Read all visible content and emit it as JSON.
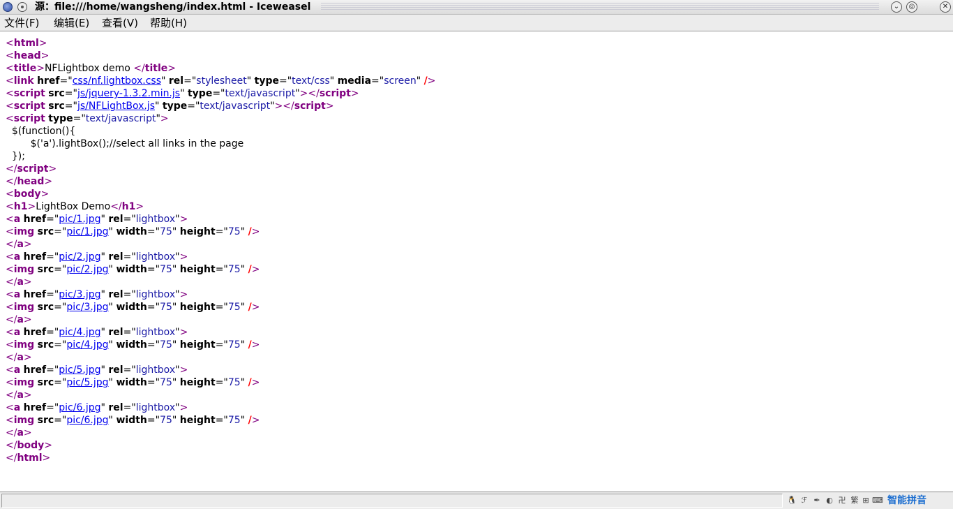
{
  "window": {
    "title": "源：file:///home/wangsheng/index.html - Iceweasel",
    "minimize_glyph": "⌄",
    "maximize_glyph": "◎"
  },
  "menu": [
    "文件(F)",
    "编辑(E)",
    "查看(V)",
    "帮助(H)"
  ],
  "source_lines": [
    [
      [
        "a",
        "<"
      ],
      [
        "t",
        "html"
      ],
      [
        "a",
        ">"
      ]
    ],
    [
      [
        "a",
        "<"
      ],
      [
        "t",
        "head"
      ],
      [
        "a",
        ">"
      ]
    ],
    [
      [
        "a",
        "<"
      ],
      [
        "t",
        "title"
      ],
      [
        "a",
        ">"
      ],
      [
        "p",
        "NFLightbox demo "
      ],
      [
        "a",
        "</"
      ],
      [
        "t",
        "title"
      ],
      [
        "a",
        ">"
      ]
    ],
    [
      [
        "a",
        "<"
      ],
      [
        "t",
        "link"
      ],
      [
        "p",
        " "
      ],
      [
        "k",
        "href"
      ],
      [
        "p",
        "=\""
      ],
      [
        "l",
        "css/nf.lightbox.css"
      ],
      [
        "p",
        "\" "
      ],
      [
        "k",
        "rel"
      ],
      [
        "p",
        "=\""
      ],
      [
        "v",
        "stylesheet"
      ],
      [
        "p",
        "\" "
      ],
      [
        "k",
        "type"
      ],
      [
        "p",
        "=\""
      ],
      [
        "v",
        "text/css"
      ],
      [
        "p",
        "\" "
      ],
      [
        "k",
        "media"
      ],
      [
        "p",
        "=\""
      ],
      [
        "v",
        "screen"
      ],
      [
        "p",
        "\" "
      ],
      [
        "s",
        "/"
      ],
      [
        "a",
        ">"
      ]
    ],
    [
      [
        "a",
        "<"
      ],
      [
        "t",
        "script"
      ],
      [
        "p",
        " "
      ],
      [
        "k",
        "src"
      ],
      [
        "p",
        "=\""
      ],
      [
        "l",
        "js/jquery-1.3.2.min.js"
      ],
      [
        "p",
        "\" "
      ],
      [
        "k",
        "type"
      ],
      [
        "p",
        "=\""
      ],
      [
        "v",
        "text/javascript"
      ],
      [
        "p",
        "\""
      ],
      [
        "a",
        "></"
      ],
      [
        "t",
        "script"
      ],
      [
        "a",
        ">"
      ]
    ],
    [
      [
        "a",
        "<"
      ],
      [
        "t",
        "script"
      ],
      [
        "p",
        " "
      ],
      [
        "k",
        "src"
      ],
      [
        "p",
        "=\""
      ],
      [
        "l",
        "js/NFLightBox.js"
      ],
      [
        "p",
        "\" "
      ],
      [
        "k",
        "type"
      ],
      [
        "p",
        "=\""
      ],
      [
        "v",
        "text/javascript"
      ],
      [
        "p",
        "\""
      ],
      [
        "a",
        "></"
      ],
      [
        "t",
        "script"
      ],
      [
        "a",
        ">"
      ]
    ],
    [
      [
        "a",
        "<"
      ],
      [
        "t",
        "script"
      ],
      [
        "p",
        " "
      ],
      [
        "k",
        "type"
      ],
      [
        "p",
        "=\""
      ],
      [
        "v",
        "text/javascript"
      ],
      [
        "p",
        "\""
      ],
      [
        "a",
        ">"
      ]
    ],
    [
      [
        "p",
        "  $(function(){"
      ]
    ],
    [
      [
        "p",
        "        $('a').lightBox();//select all links in the page"
      ]
    ],
    [
      [
        "p",
        "  });"
      ]
    ],
    [
      [
        "a",
        "</"
      ],
      [
        "t",
        "script"
      ],
      [
        "a",
        ">"
      ]
    ],
    [
      [
        "a",
        "</"
      ],
      [
        "t",
        "head"
      ],
      [
        "a",
        ">"
      ]
    ],
    [
      [
        "a",
        "<"
      ],
      [
        "t",
        "body"
      ],
      [
        "a",
        ">"
      ]
    ],
    [
      [
        "a",
        "<"
      ],
      [
        "t",
        "h1"
      ],
      [
        "a",
        ">"
      ],
      [
        "p",
        "LightBox Demo"
      ],
      [
        "a",
        "</"
      ],
      [
        "t",
        "h1"
      ],
      [
        "a",
        ">"
      ]
    ],
    [
      [
        "a",
        "<"
      ],
      [
        "t",
        "a"
      ],
      [
        "p",
        " "
      ],
      [
        "k",
        "href"
      ],
      [
        "p",
        "=\""
      ],
      [
        "l",
        "pic/1.jpg"
      ],
      [
        "p",
        "\" "
      ],
      [
        "k",
        "rel"
      ],
      [
        "p",
        "=\""
      ],
      [
        "v",
        "lightbox"
      ],
      [
        "p",
        "\""
      ],
      [
        "a",
        ">"
      ]
    ],
    [
      [
        "a",
        "<"
      ],
      [
        "t",
        "img"
      ],
      [
        "p",
        " "
      ],
      [
        "k",
        "src"
      ],
      [
        "p",
        "=\""
      ],
      [
        "l",
        "pic/1.jpg"
      ],
      [
        "p",
        "\" "
      ],
      [
        "k",
        "width"
      ],
      [
        "p",
        "=\""
      ],
      [
        "v",
        "75"
      ],
      [
        "p",
        "\" "
      ],
      [
        "k",
        "height"
      ],
      [
        "p",
        "=\""
      ],
      [
        "v",
        "75"
      ],
      [
        "p",
        "\" "
      ],
      [
        "s",
        "/"
      ],
      [
        "a",
        ">"
      ]
    ],
    [
      [
        "a",
        "</"
      ],
      [
        "t",
        "a"
      ],
      [
        "a",
        ">"
      ]
    ],
    [
      [
        "a",
        "<"
      ],
      [
        "t",
        "a"
      ],
      [
        "p",
        " "
      ],
      [
        "k",
        "href"
      ],
      [
        "p",
        "=\""
      ],
      [
        "l",
        "pic/2.jpg"
      ],
      [
        "p",
        "\" "
      ],
      [
        "k",
        "rel"
      ],
      [
        "p",
        "=\""
      ],
      [
        "v",
        "lightbox"
      ],
      [
        "p",
        "\""
      ],
      [
        "a",
        ">"
      ]
    ],
    [
      [
        "a",
        "<"
      ],
      [
        "t",
        "img"
      ],
      [
        "p",
        " "
      ],
      [
        "k",
        "src"
      ],
      [
        "p",
        "=\""
      ],
      [
        "l",
        "pic/2.jpg"
      ],
      [
        "p",
        "\" "
      ],
      [
        "k",
        "width"
      ],
      [
        "p",
        "=\""
      ],
      [
        "v",
        "75"
      ],
      [
        "p",
        "\" "
      ],
      [
        "k",
        "height"
      ],
      [
        "p",
        "=\""
      ],
      [
        "v",
        "75"
      ],
      [
        "p",
        "\" "
      ],
      [
        "s",
        "/"
      ],
      [
        "a",
        ">"
      ]
    ],
    [
      [
        "a",
        "</"
      ],
      [
        "t",
        "a"
      ],
      [
        "a",
        ">"
      ]
    ],
    [
      [
        "a",
        "<"
      ],
      [
        "t",
        "a"
      ],
      [
        "p",
        " "
      ],
      [
        "k",
        "href"
      ],
      [
        "p",
        "=\""
      ],
      [
        "l",
        "pic/3.jpg"
      ],
      [
        "p",
        "\" "
      ],
      [
        "k",
        "rel"
      ],
      [
        "p",
        "=\""
      ],
      [
        "v",
        "lightbox"
      ],
      [
        "p",
        "\""
      ],
      [
        "a",
        ">"
      ]
    ],
    [
      [
        "a",
        "<"
      ],
      [
        "t",
        "img"
      ],
      [
        "p",
        " "
      ],
      [
        "k",
        "src"
      ],
      [
        "p",
        "=\""
      ],
      [
        "l",
        "pic/3.jpg"
      ],
      [
        "p",
        "\" "
      ],
      [
        "k",
        "width"
      ],
      [
        "p",
        "=\""
      ],
      [
        "v",
        "75"
      ],
      [
        "p",
        "\" "
      ],
      [
        "k",
        "height"
      ],
      [
        "p",
        "=\""
      ],
      [
        "v",
        "75"
      ],
      [
        "p",
        "\" "
      ],
      [
        "s",
        "/"
      ],
      [
        "a",
        ">"
      ]
    ],
    [
      [
        "a",
        "</"
      ],
      [
        "t",
        "a"
      ],
      [
        "a",
        ">"
      ]
    ],
    [
      [
        "a",
        "<"
      ],
      [
        "t",
        "a"
      ],
      [
        "p",
        " "
      ],
      [
        "k",
        "href"
      ],
      [
        "p",
        "=\""
      ],
      [
        "l",
        "pic/4.jpg"
      ],
      [
        "p",
        "\" "
      ],
      [
        "k",
        "rel"
      ],
      [
        "p",
        "=\""
      ],
      [
        "v",
        "lightbox"
      ],
      [
        "p",
        "\""
      ],
      [
        "a",
        ">"
      ]
    ],
    [
      [
        "a",
        "<"
      ],
      [
        "t",
        "img"
      ],
      [
        "p",
        " "
      ],
      [
        "k",
        "src"
      ],
      [
        "p",
        "=\""
      ],
      [
        "l",
        "pic/4.jpg"
      ],
      [
        "p",
        "\" "
      ],
      [
        "k",
        "width"
      ],
      [
        "p",
        "=\""
      ],
      [
        "v",
        "75"
      ],
      [
        "p",
        "\" "
      ],
      [
        "k",
        "height"
      ],
      [
        "p",
        "=\""
      ],
      [
        "v",
        "75"
      ],
      [
        "p",
        "\" "
      ],
      [
        "s",
        "/"
      ],
      [
        "a",
        ">"
      ]
    ],
    [
      [
        "a",
        "</"
      ],
      [
        "t",
        "a"
      ],
      [
        "a",
        ">"
      ]
    ],
    [
      [
        "a",
        "<"
      ],
      [
        "t",
        "a"
      ],
      [
        "p",
        " "
      ],
      [
        "k",
        "href"
      ],
      [
        "p",
        "=\""
      ],
      [
        "l",
        "pic/5.jpg"
      ],
      [
        "p",
        "\" "
      ],
      [
        "k",
        "rel"
      ],
      [
        "p",
        "=\""
      ],
      [
        "v",
        "lightbox"
      ],
      [
        "p",
        "\""
      ],
      [
        "a",
        ">"
      ]
    ],
    [
      [
        "a",
        "<"
      ],
      [
        "t",
        "img"
      ],
      [
        "p",
        " "
      ],
      [
        "k",
        "src"
      ],
      [
        "p",
        "=\""
      ],
      [
        "l",
        "pic/5.jpg"
      ],
      [
        "p",
        "\" "
      ],
      [
        "k",
        "width"
      ],
      [
        "p",
        "=\""
      ],
      [
        "v",
        "75"
      ],
      [
        "p",
        "\" "
      ],
      [
        "k",
        "height"
      ],
      [
        "p",
        "=\""
      ],
      [
        "v",
        "75"
      ],
      [
        "p",
        "\" "
      ],
      [
        "s",
        "/"
      ],
      [
        "a",
        ">"
      ]
    ],
    [
      [
        "a",
        "</"
      ],
      [
        "t",
        "a"
      ],
      [
        "a",
        ">"
      ]
    ],
    [
      [
        "a",
        "<"
      ],
      [
        "t",
        "a"
      ],
      [
        "p",
        " "
      ],
      [
        "k",
        "href"
      ],
      [
        "p",
        "=\""
      ],
      [
        "l",
        "pic/6.jpg"
      ],
      [
        "p",
        "\" "
      ],
      [
        "k",
        "rel"
      ],
      [
        "p",
        "=\""
      ],
      [
        "v",
        "lightbox"
      ],
      [
        "p",
        "\""
      ],
      [
        "a",
        ">"
      ]
    ],
    [
      [
        "a",
        "<"
      ],
      [
        "t",
        "img"
      ],
      [
        "p",
        " "
      ],
      [
        "k",
        "src"
      ],
      [
        "p",
        "=\""
      ],
      [
        "l",
        "pic/6.jpg"
      ],
      [
        "p",
        "\" "
      ],
      [
        "k",
        "width"
      ],
      [
        "p",
        "=\""
      ],
      [
        "v",
        "75"
      ],
      [
        "p",
        "\" "
      ],
      [
        "k",
        "height"
      ],
      [
        "p",
        "=\""
      ],
      [
        "v",
        "75"
      ],
      [
        "p",
        "\" "
      ],
      [
        "s",
        "/"
      ],
      [
        "a",
        ">"
      ]
    ],
    [
      [
        "a",
        "</"
      ],
      [
        "t",
        "a"
      ],
      [
        "a",
        ">"
      ]
    ],
    [
      [
        "a",
        "</"
      ],
      [
        "t",
        "body"
      ],
      [
        "a",
        ">"
      ]
    ],
    [
      [
        "a",
        "</"
      ],
      [
        "t",
        "html"
      ],
      [
        "a",
        ">"
      ]
    ]
  ],
  "statusbar": {
    "text": "",
    "tray_icons": [
      "tux-icon",
      "input-mode-icon",
      "feather-icon",
      "half-width-icon",
      "punctuation-icon",
      "traditional-chinese-icon",
      "soft-keyboard-icon",
      "keyboard-icon"
    ],
    "tray_glyphs": [
      "🐧",
      "ℱ",
      "✒",
      "◐",
      "卍",
      "繁",
      "⊞",
      "⌨"
    ],
    "ime_name": "智能拼音"
  }
}
